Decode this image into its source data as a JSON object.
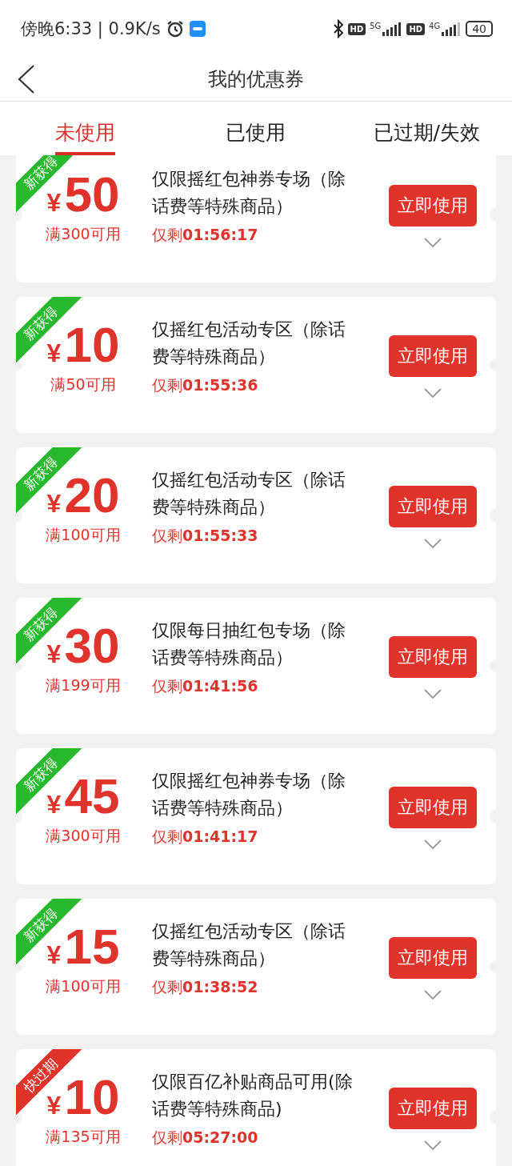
{
  "status_bar": {
    "time": "傍晚6:33 | 0.9K/s",
    "hd_badges": [
      "HD",
      "HD"
    ],
    "networks": [
      "5G",
      "4G"
    ],
    "battery": "40"
  },
  "header": {
    "title": "我的优惠券"
  },
  "tabs": [
    {
      "label": "未使用",
      "selected": true
    },
    {
      "label": "已使用",
      "selected": false
    },
    {
      "label": "已过期/失效",
      "selected": false
    }
  ],
  "coupons": [
    {
      "tag": {
        "kind": "new",
        "label": "新获得"
      },
      "currency": "¥",
      "amount": "50",
      "condition": "满300可用",
      "title": "仅限摇红包神券专场（除话费等特殊商品）",
      "countdown": "仅剩**01:56:17**",
      "button": "立即使用"
    },
    {
      "tag": {
        "kind": "new",
        "label": "新获得"
      },
      "currency": "¥",
      "amount": "10",
      "condition": "满50可用",
      "title": "仅摇红包活动专区（除话费等特殊商品）",
      "countdown": "仅剩**01:55:36**",
      "button": "立即使用"
    },
    {
      "tag": {
        "kind": "new",
        "label": "新获得"
      },
      "currency": "¥",
      "amount": "20",
      "condition": "满100可用",
      "title": "仅摇红包活动专区（除话费等特殊商品）",
      "countdown": "仅剩**01:55:33**",
      "button": "立即使用"
    },
    {
      "tag": {
        "kind": "new",
        "label": "新获得"
      },
      "currency": "¥",
      "amount": "30",
      "condition": "满199可用",
      "title": "仅限每日抽红包专场（除话费等特殊商品）",
      "countdown": "仅剩**01:41:56**",
      "button": "立即使用"
    },
    {
      "tag": {
        "kind": "new",
        "label": "新获得"
      },
      "currency": "¥",
      "amount": "45",
      "condition": "满300可用",
      "title": "仅限摇红包神券专场（除话费等特殊商品）",
      "countdown": "仅剩**01:41:17**",
      "button": "立即使用"
    },
    {
      "tag": {
        "kind": "new",
        "label": "新获得"
      },
      "currency": "¥",
      "amount": "15",
      "condition": "满100可用",
      "title": "仅摇红包活动专区（除话费等特殊商品）",
      "countdown": "仅剩**01:38:52**",
      "button": "立即使用"
    },
    {
      "tag": {
        "kind": "expiring",
        "label": "快过期"
      },
      "currency": "¥",
      "amount": "10",
      "condition": "满135可用",
      "title": "仅限百亿补贴商品可用(除话费等特殊商品)",
      "countdown": "仅剩**05:27:00**",
      "button": "立即使用"
    }
  ]
}
